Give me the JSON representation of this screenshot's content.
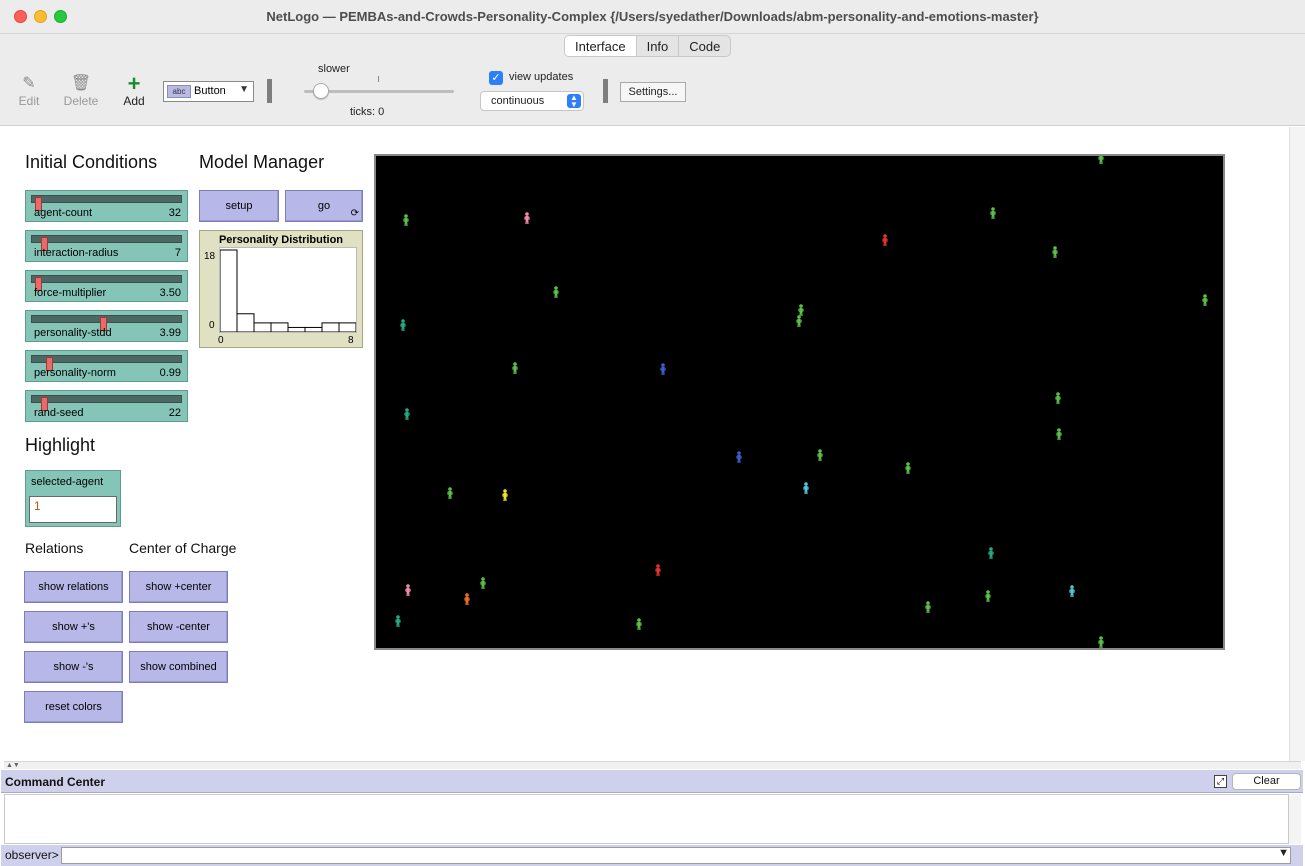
{
  "window": {
    "title": "NetLogo — PEMBAs-and-Crowds-Personality-Complex {/Users/syedather/Downloads/abm-personality-and-emotions-master}"
  },
  "tabs": [
    "Interface",
    "Info",
    "Code"
  ],
  "toolbar": {
    "edit_label": "Edit",
    "delete_label": "Delete",
    "add_label": "Add",
    "widget_type": "Button",
    "speed_label": "slower",
    "speed_value": 0.1,
    "ticks_label": "ticks: 0",
    "view_updates_label": "view updates",
    "view_updates_checked": true,
    "update_mode": "continuous",
    "settings_label": "Settings..."
  },
  "headings": {
    "initial_conditions": "Initial Conditions",
    "model_manager": "Model Manager",
    "highlight": "Highlight",
    "relations": "Relations",
    "center_of_charge": "Center of Charge"
  },
  "sliders": [
    {
      "name": "agent-count",
      "value": "32",
      "position": 0.02
    },
    {
      "name": "interaction-radius",
      "value": "7",
      "position": 0.06
    },
    {
      "name": "force-multiplier",
      "value": "3.50",
      "position": 0.02
    },
    {
      "name": "personality-stdd",
      "value": "3.99",
      "position": 0.48
    },
    {
      "name": "personality-norm",
      "value": "0.99",
      "position": 0.1
    },
    {
      "name": "rand-seed",
      "value": "22",
      "position": 0.06
    }
  ],
  "buttons": {
    "setup": "setup",
    "go": "go",
    "show_relations": "show relations",
    "show_pos": "show +'s",
    "show_neg": "show -'s",
    "reset_colors": "reset colors",
    "show_pos_center": "show +center",
    "show_neg_center": "show -center",
    "show_combined": "show combined"
  },
  "plot": {
    "title": "Personality Distribution",
    "y_max_label": "18",
    "y_min_label": "0",
    "x_min_label": "0",
    "x_max_label": "8"
  },
  "chart_data": {
    "type": "bar",
    "title": "Personality Distribution",
    "xlim": [
      0,
      8
    ],
    "ylim": [
      0,
      18
    ],
    "values": [
      18,
      4,
      2,
      2,
      1,
      1,
      2,
      2
    ]
  },
  "highlight_input": {
    "name": "selected-agent",
    "value": "1"
  },
  "colors": {
    "slider_bg": "#84c5b8",
    "button_bg": "#b8b8e8",
    "plot_bg": "#e0e0c2",
    "world_bg": "#000000"
  },
  "agents": [
    {
      "x": 1101,
      "y": 158,
      "c": "#5cbf4a"
    },
    {
      "x": 406,
      "y": 220,
      "c": "#5cbf4a"
    },
    {
      "x": 527,
      "y": 218,
      "c": "#f08ca8"
    },
    {
      "x": 993,
      "y": 213,
      "c": "#5cbf4a"
    },
    {
      "x": 885,
      "y": 240,
      "c": "#e0362c"
    },
    {
      "x": 1055,
      "y": 252,
      "c": "#5cbf4a"
    },
    {
      "x": 556,
      "y": 292,
      "c": "#5cbf4a"
    },
    {
      "x": 1205,
      "y": 300,
      "c": "#5cbf4a"
    },
    {
      "x": 801,
      "y": 310,
      "c": "#5cbf4a"
    },
    {
      "x": 799,
      "y": 321,
      "c": "#5cbf4a"
    },
    {
      "x": 403,
      "y": 325,
      "c": "#29a884"
    },
    {
      "x": 515,
      "y": 368,
      "c": "#5cbf4a"
    },
    {
      "x": 663,
      "y": 369,
      "c": "#3a5fcd"
    },
    {
      "x": 1058,
      "y": 398,
      "c": "#5cbf4a"
    },
    {
      "x": 407,
      "y": 414,
      "c": "#29a884"
    },
    {
      "x": 1059,
      "y": 434,
      "c": "#5cbf4a"
    },
    {
      "x": 739,
      "y": 457,
      "c": "#3a5fcd"
    },
    {
      "x": 820,
      "y": 455,
      "c": "#5cbf4a"
    },
    {
      "x": 908,
      "y": 468,
      "c": "#5cbf4a"
    },
    {
      "x": 806,
      "y": 488,
      "c": "#52c6d8"
    },
    {
      "x": 450,
      "y": 493,
      "c": "#5cbf4a"
    },
    {
      "x": 505,
      "y": 495,
      "c": "#f2e22c"
    },
    {
      "x": 991,
      "y": 553,
      "c": "#29a884"
    },
    {
      "x": 658,
      "y": 570,
      "c": "#e0362c"
    },
    {
      "x": 483,
      "y": 583,
      "c": "#5cbf4a"
    },
    {
      "x": 408,
      "y": 590,
      "c": "#f08ca8"
    },
    {
      "x": 1072,
      "y": 591,
      "c": "#52c6d8"
    },
    {
      "x": 467,
      "y": 599,
      "c": "#f0701e"
    },
    {
      "x": 988,
      "y": 596,
      "c": "#5cbf4a"
    },
    {
      "x": 928,
      "y": 607,
      "c": "#5cbf4a"
    },
    {
      "x": 398,
      "y": 621,
      "c": "#29a884"
    },
    {
      "x": 639,
      "y": 624,
      "c": "#5cbf4a"
    },
    {
      "x": 1101,
      "y": 642,
      "c": "#5cbf4a"
    }
  ],
  "command_center": {
    "title": "Command Center",
    "clear_label": "Clear",
    "observer_label": "observer>",
    "input_value": ""
  }
}
